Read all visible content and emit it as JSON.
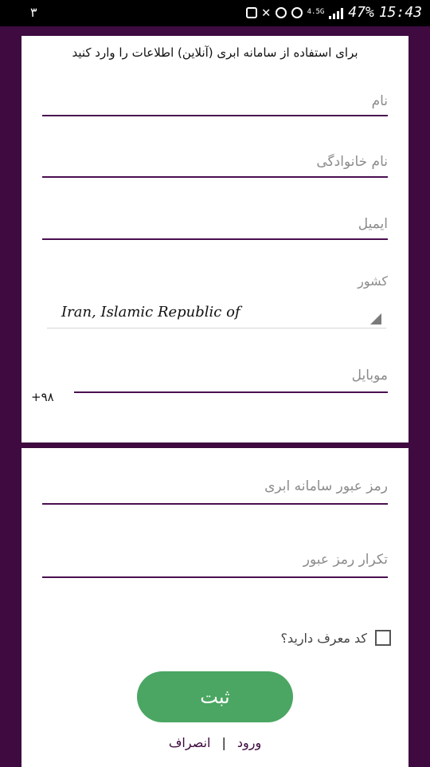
{
  "status_bar": {
    "left_text": "۳",
    "network": "4.5G",
    "battery": "47%",
    "time": "15:43"
  },
  "form": {
    "title": "برای استفاده از سامانه ابری (آنلاین) اطلاعات را وارد کنید",
    "first_name_placeholder": "نام",
    "last_name_placeholder": "نام خانوادگی",
    "email_placeholder": "ایمیل",
    "country_label": "کشور",
    "country_value": "Iran, Islamic Republic of",
    "mobile_placeholder": "موبایل",
    "mobile_prefix": "+۹۸"
  },
  "password_section": {
    "password_placeholder": "رمز عبور سامانه ابری",
    "confirm_placeholder": "تکرار رمز عبور",
    "referral_label": "کد معرف دارید؟",
    "submit_label": "ثبت",
    "login_link": "ورود",
    "separator": "|",
    "cancel_link": "انصراف"
  },
  "colors": {
    "background": "#3e0a3f",
    "accent_line": "#4a1050",
    "button": "#4aa662"
  }
}
